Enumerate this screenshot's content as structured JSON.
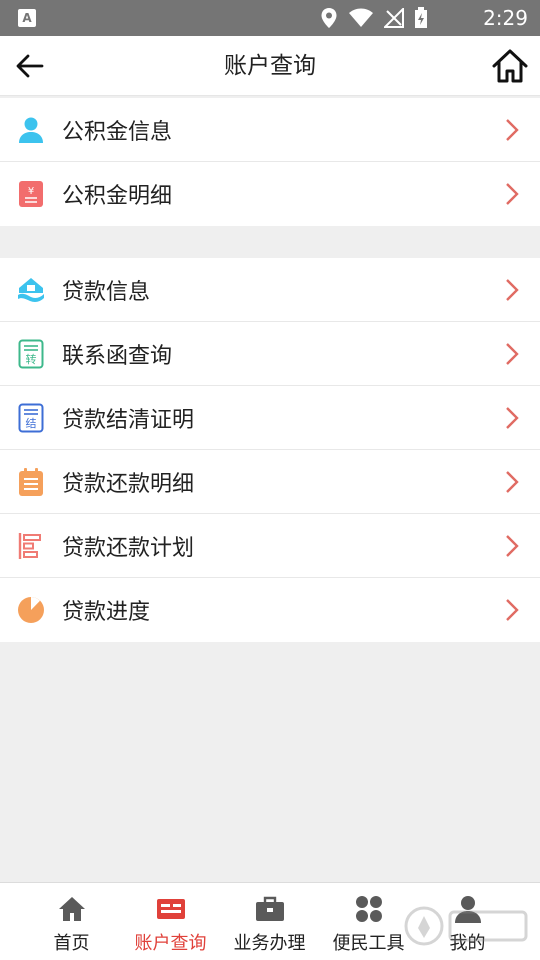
{
  "status_bar": {
    "time": "2:29"
  },
  "header": {
    "title": "账户查询"
  },
  "groups": [
    {
      "items": [
        {
          "label": "公积金信息"
        },
        {
          "label": "公积金明细"
        }
      ]
    },
    {
      "items": [
        {
          "label": "贷款信息"
        },
        {
          "label": "联系函查询"
        },
        {
          "label": "贷款结清证明"
        },
        {
          "label": "贷款还款明细"
        },
        {
          "label": "贷款还款计划"
        },
        {
          "label": "贷款进度"
        }
      ]
    }
  ],
  "icon_glyphs": {
    "yen": "¥",
    "zhuan": "转",
    "jie": "结"
  },
  "tabs": [
    {
      "label": "首页",
      "icon": "home-icon"
    },
    {
      "label": "账户查询",
      "icon": "id-card-icon",
      "active": true
    },
    {
      "label": "业务办理",
      "icon": "briefcase-icon"
    },
    {
      "label": "便民工具",
      "icon": "grid-icon"
    },
    {
      "label": "我的",
      "icon": "user-icon"
    }
  ],
  "colors": {
    "accent": "#e0413a",
    "chevron": "#e06b63",
    "status_bar": "#757575"
  }
}
